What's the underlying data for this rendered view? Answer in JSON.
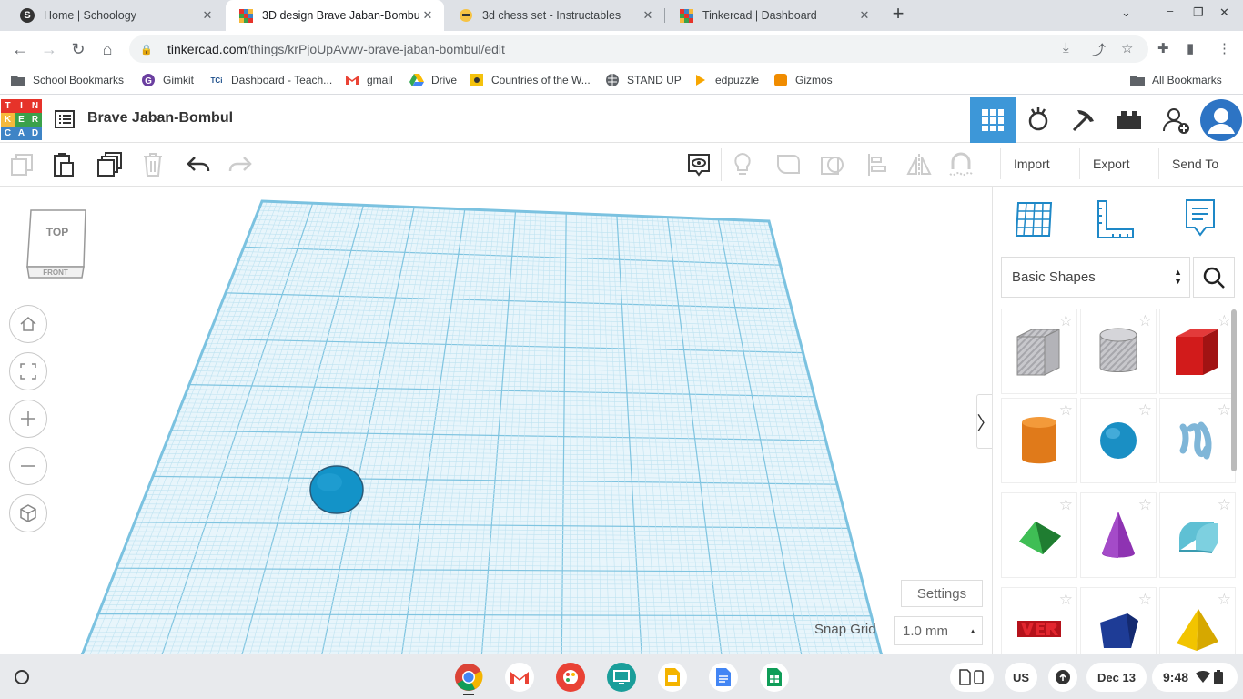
{
  "browser": {
    "tabs": [
      {
        "title": "Home | Schoology",
        "favicon": "schoology-icon",
        "active": false
      },
      {
        "title": "3D design Brave Jaban-Bombul",
        "favicon": "tinkercad-icon",
        "active": true
      },
      {
        "title": "3d chess set - Instructables",
        "favicon": "instructables-icon",
        "active": false
      },
      {
        "title": "Tinkercad | Dashboard",
        "favicon": "tinkercad-icon",
        "active": false
      }
    ],
    "url_host": "tinkercad.com",
    "url_path": "/things/krPjoUpAvwv-brave-jaban-bombul/edit",
    "bookmarks": [
      {
        "label": "School Bookmarks",
        "icon": "folder-icon"
      },
      {
        "label": "Gimkit",
        "icon": "gimkit-icon"
      },
      {
        "label": "Dashboard - Teach...",
        "icon": "tci-icon"
      },
      {
        "label": "gmail",
        "icon": "gmail-icon"
      },
      {
        "label": "Drive",
        "icon": "drive-icon"
      },
      {
        "label": "Countries of the W...",
        "icon": "countries-icon"
      },
      {
        "label": "STAND UP",
        "icon": "globe-icon"
      },
      {
        "label": "edpuzzle",
        "icon": "edpuzzle-icon"
      },
      {
        "label": "Gizmos",
        "icon": "gizmos-icon"
      }
    ],
    "all_bookmarks": "All Bookmarks"
  },
  "tinkercad": {
    "logo_letters": [
      "T",
      "I",
      "N",
      "K",
      "E",
      "R",
      "C",
      "A",
      "D"
    ],
    "design_title": "Brave Jaban-Bombul",
    "toolbar": {
      "import": "Import",
      "export": "Export",
      "send_to": "Send To"
    },
    "viewcube": {
      "top": "TOP",
      "front": "FRONT"
    },
    "settings": "Settings",
    "snap_grid_label": "Snap Grid",
    "snap_grid_value": "1.0 mm",
    "shape_category": "Basic Shapes",
    "shapes": [
      "box-hole",
      "cylinder-hole",
      "box",
      "cylinder",
      "sphere",
      "scribble",
      "roof",
      "cone",
      "round-roof",
      "text",
      "polygon",
      "pyramid"
    ]
  },
  "shelf": {
    "date": "Dec 13",
    "time": "9:48",
    "keyboard": "US"
  },
  "colors": {
    "accent": "#3d97d8",
    "grid": "#a9d8ea",
    "sphere": "#1393c8"
  }
}
